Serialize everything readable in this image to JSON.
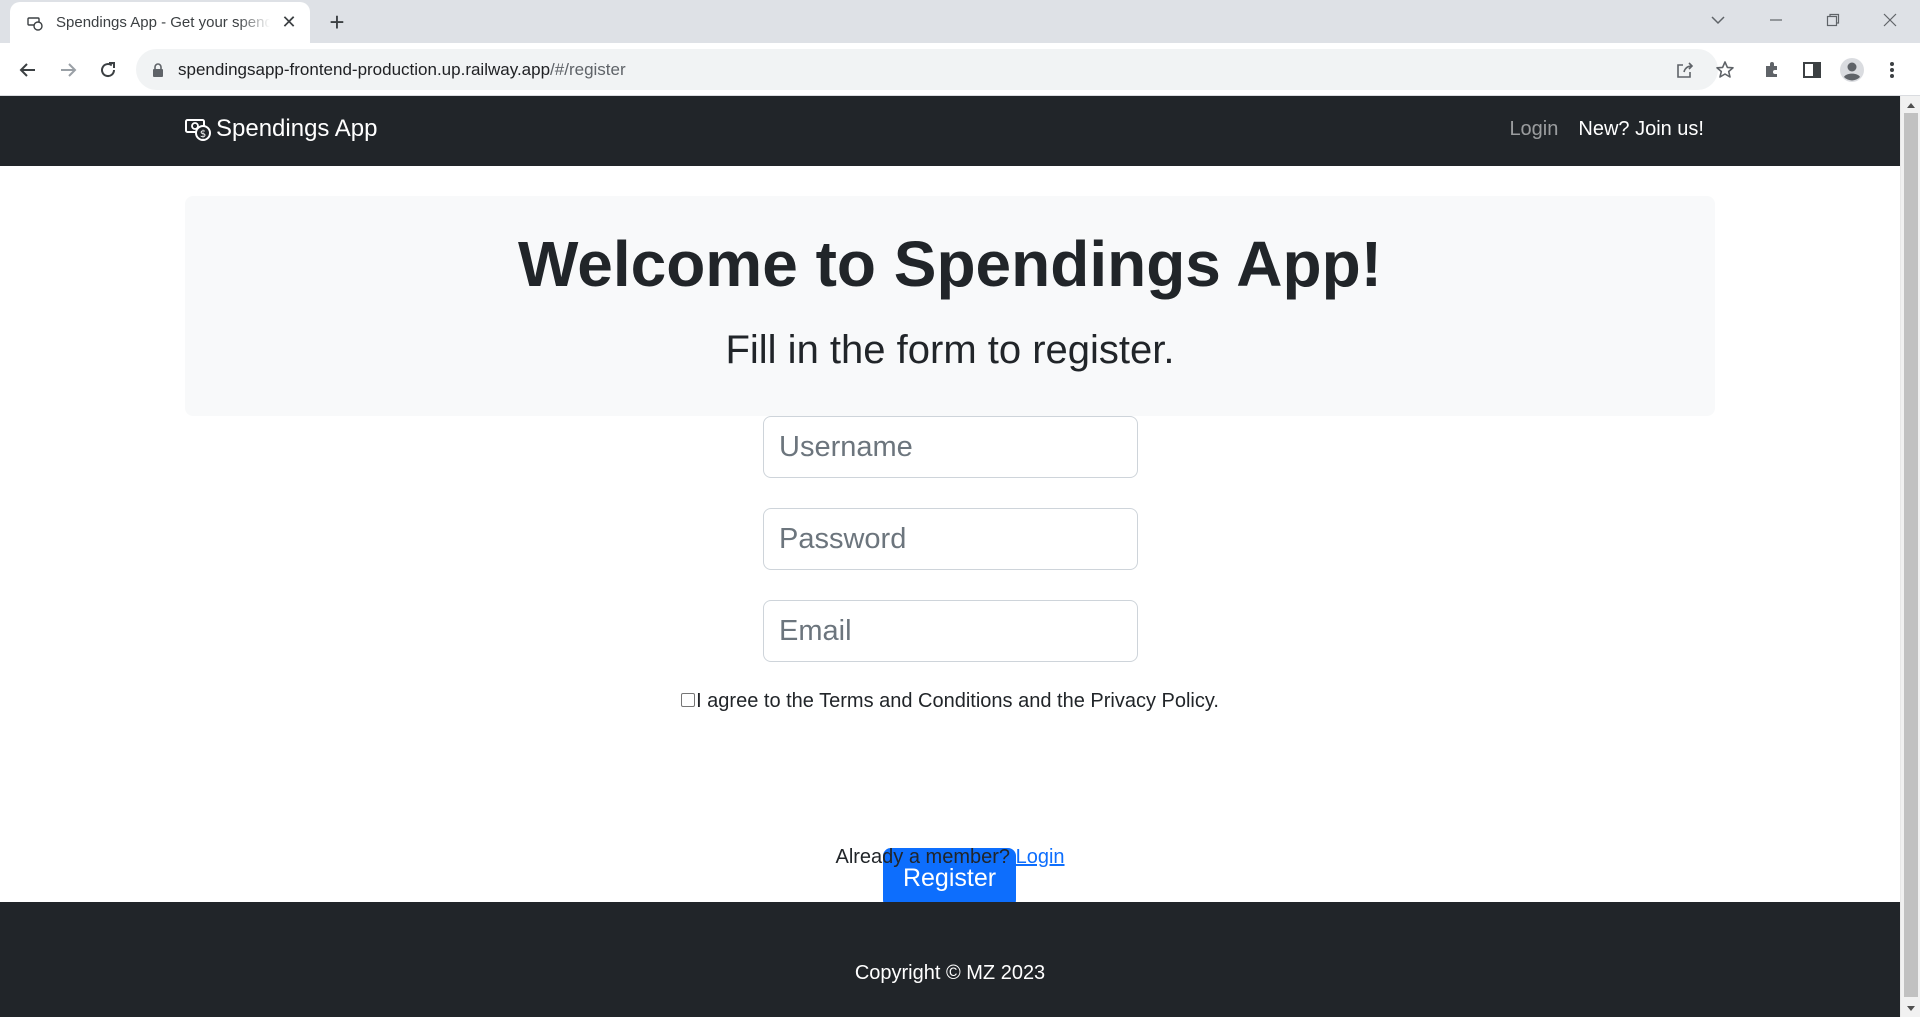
{
  "browser": {
    "tab_title": "Spendings App - Get your spendings",
    "new_tab_symbol": "+",
    "close_symbol": "✕",
    "url_host": "spendingsapp-frontend-production.up.railway.app",
    "url_path": "/#/register",
    "icons": [
      "back-icon",
      "forward-icon",
      "reload-icon",
      "lock-icon",
      "share-icon",
      "star-icon",
      "extensions-icon",
      "side-panel-icon",
      "profile-icon",
      "menu-icon"
    ]
  },
  "navbar": {
    "brand": "Spendings App",
    "login": "Login",
    "join": "New? Join us!"
  },
  "hero": {
    "title": "Welcome to Spendings App!",
    "subtitle": "Fill in the form to register."
  },
  "form": {
    "username_placeholder": "Username",
    "password_placeholder": "Password",
    "email_placeholder": "Email",
    "agree_text": "I agree to the Terms and Conditions and the Privacy Policy.",
    "register_label": "Register",
    "member_text": "Already a member?",
    "login_link": "Login"
  },
  "footer": {
    "copyright": "Copyright © MZ 2023"
  },
  "colors": {
    "navbar_bg": "#212529",
    "hero_bg": "#f8f9fa",
    "primary": "#0d6efd"
  }
}
